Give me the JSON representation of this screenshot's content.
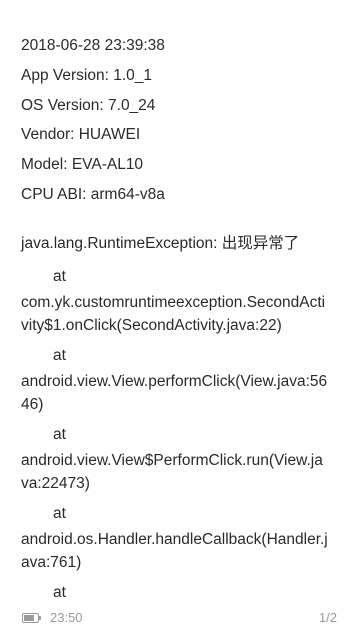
{
  "report": {
    "timestamp": "2018-06-28 23:39:38",
    "app_version": "App Version: 1.0_1",
    "os_version": "OS Version: 7.0_24",
    "vendor": "Vendor: HUAWEI",
    "model": "Model: EVA-AL10",
    "cpu_abi": "CPU ABI: arm64-v8a"
  },
  "stacktrace": {
    "exception": "java.lang.RuntimeException: 出现异常了",
    "lines": [
      "at",
      "com.yk.customruntimeexception.SecondActi",
      "vity$1.onClick(SecondActivity.java:22)",
      "at",
      "android.view.View.performClick(View.java:56",
      "46)",
      "at",
      "android.view.View$PerformClick.run(View.ja",
      "va:22473)",
      "at",
      "android.os.Handler.handleCallback(Handler.j",
      "ava:761)",
      "at"
    ]
  },
  "status_bar": {
    "time": "23:50",
    "page": "1/2",
    "battery_level": 0.8,
    "battery_icon": "battery-icon"
  }
}
